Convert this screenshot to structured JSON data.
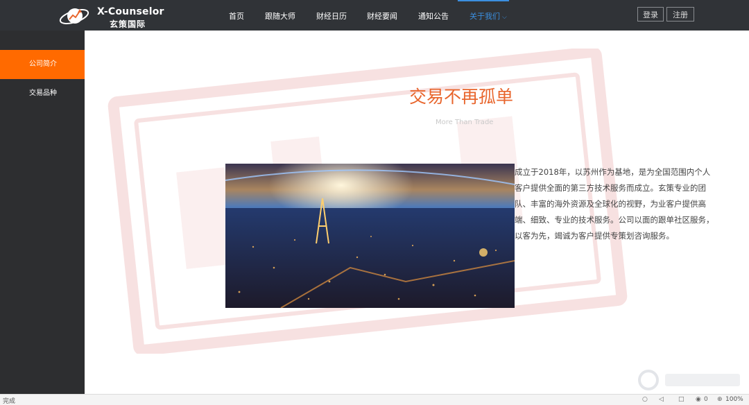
{
  "brand": {
    "name_en": "X-Counselor",
    "name_cn": "玄策国际"
  },
  "nav": {
    "items": [
      "首页",
      "跟随大师",
      "财经日历",
      "财经要闻",
      "通知公告"
    ],
    "active": "关于我们"
  },
  "auth": {
    "login": "登录",
    "register": "注册"
  },
  "sidebar": {
    "items": [
      {
        "label": "公司简介"
      },
      {
        "label": "交易品种"
      }
    ]
  },
  "main": {
    "heading": "交易不再孤单",
    "subheading": "More Than Trade",
    "intro": "成立于2018年，以苏州作为基地，是为全国范围内个人客户提供全面的第三方技术服务而成立。玄策专业的团队、丰富的海外资源及全球化的视野，为业客户提供高端、细致、专业的技术服务。公司以面的跟单社区服务，以客为先，竭诚为客户提供专策划咨询服务。"
  },
  "statusbar": {
    "left_text": "完成",
    "zoom": "100%",
    "count": "0"
  },
  "colors": {
    "accent": "#ff6a00",
    "heading": "#e8652c",
    "nav_active": "#3b8fe0",
    "topbar": "#303337",
    "sidebar": "#2d2e30"
  }
}
